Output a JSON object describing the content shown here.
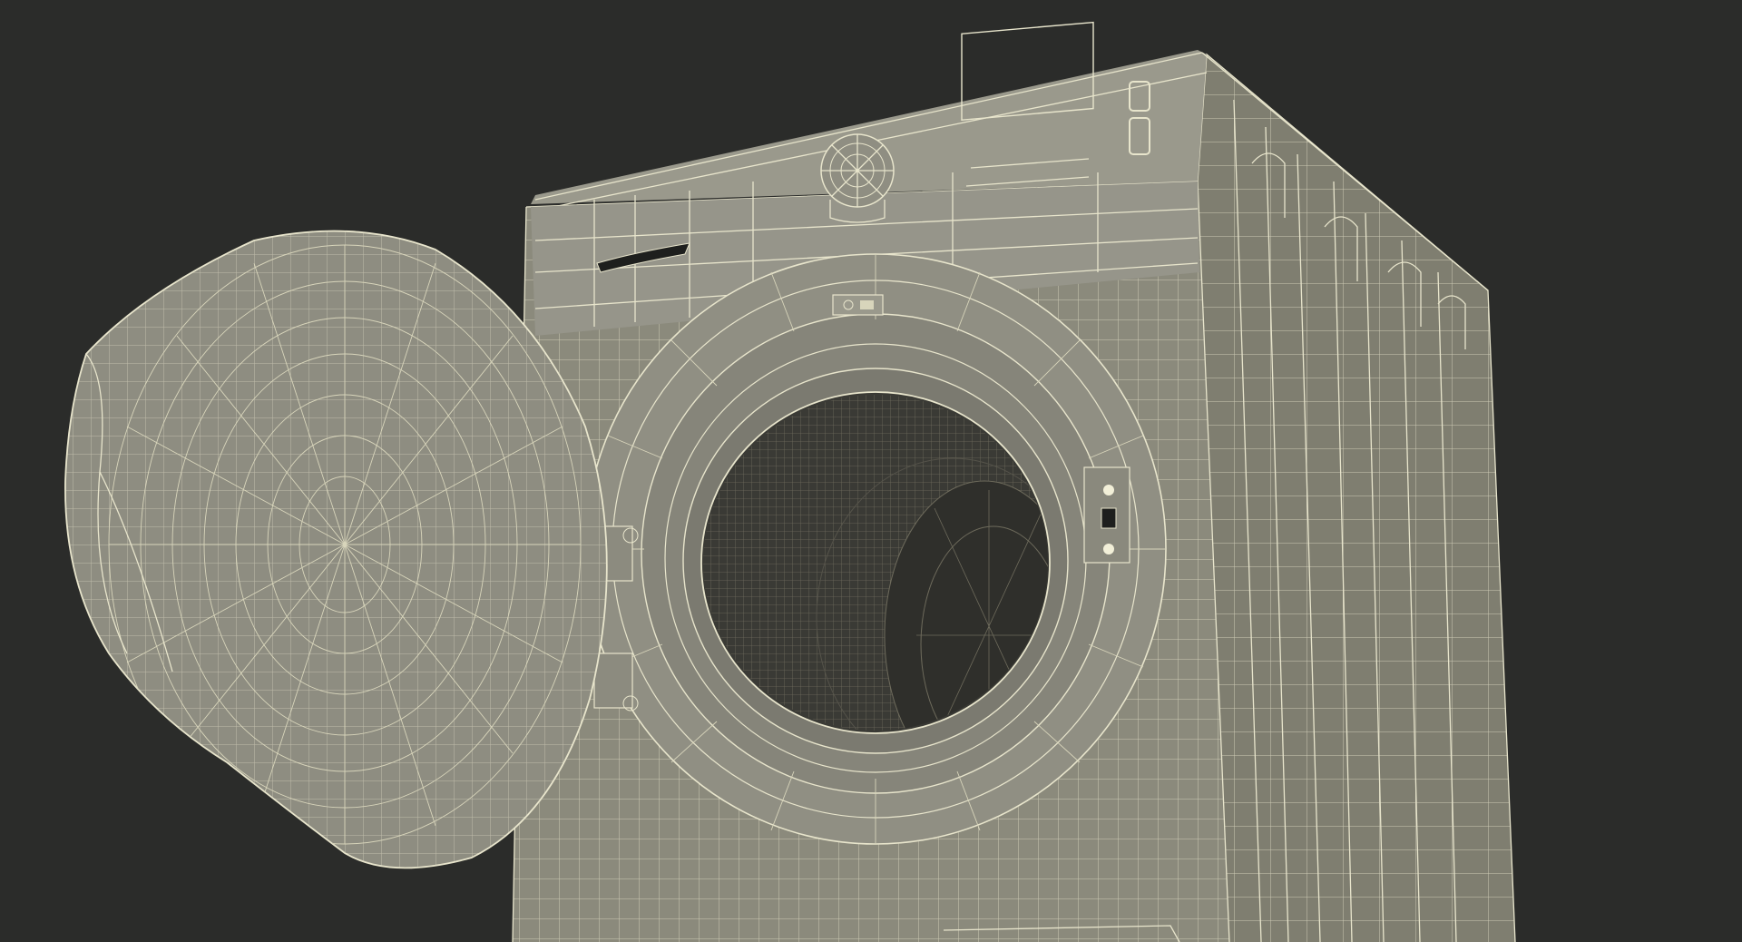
{
  "scene": {
    "subject": "washing-machine-wireframe",
    "colors": {
      "background": "#2b2c2a",
      "body": "#8b8a7c",
      "body_side": "#7f7e70",
      "panel": "#96958a",
      "wire": "#e8e5cc",
      "drum": "#3a3a35",
      "drum_wire": "#6e6b5c"
    },
    "icons": [
      "control-knob-icon",
      "display-panel-icon",
      "door-hinge-icon",
      "door-latch-icon"
    ]
  }
}
